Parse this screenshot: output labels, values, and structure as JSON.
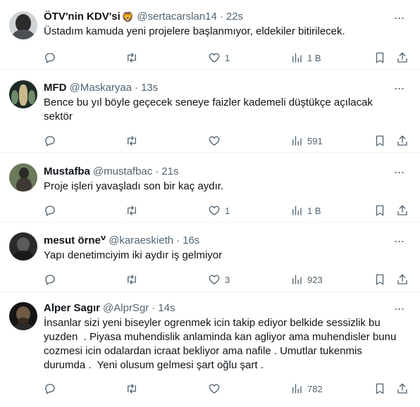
{
  "tweets": [
    {
      "name": "ÖTV'nin KDV'si",
      "badge": "🦁",
      "handle": "@sertacarslan14",
      "time": "22s",
      "text": "Üstadım kamuda yeni projelere başlanmıyor, eldekiler bitirilecek.",
      "likes": "1",
      "views": "1 B",
      "retweets": "",
      "replies": ""
    },
    {
      "name": "MFD",
      "handle": "@Maskaryaa",
      "time": "13s",
      "text": "Bence bu yıl böyle geçecek seneye faizler kademeli düştükçe açılacak\nsektör",
      "likes": "",
      "views": "591",
      "retweets": "",
      "replies": ""
    },
    {
      "name": "Mustafba",
      "handle": "@mustafbac",
      "time": "21s",
      "text": "Proje işleri yavaşladı son bir kaç aydır.",
      "likes": "1",
      "views": "1 B",
      "retweets": "",
      "replies": ""
    },
    {
      "name": "mesut örneⱽ",
      "handle": "@karaeskieth",
      "time": "16s",
      "text": "Yapı denetimciyim iki aydır iş gelmiyor",
      "likes": "3",
      "views": "923",
      "retweets": "",
      "replies": ""
    },
    {
      "name": "Alper Sagır",
      "handle": "@AlprSgr",
      "time": "14s",
      "text": "İnsanlar sizi yeni biseyler ogrenmek icin takip ediyor belkide sessizlik bu\nyuzden  . Piyasa muhendislik anlaminda kan agliyor ama muhendisler bunu\ncozmesi icin odalardan icraat bekliyor ama nafile . Umutlar tukenmis\ndurumda .  Yeni olusum gelmesi şart oğlu şart .",
      "likes": "",
      "views": "782",
      "retweets": "",
      "replies": ""
    }
  ],
  "separator": "·",
  "more_glyph": "···",
  "colors": {
    "text_primary": "#0f1419",
    "text_secondary": "#536471",
    "divider": "#eff3f4"
  },
  "icons": [
    "reply-icon",
    "retweet-icon",
    "like-icon",
    "views-icon",
    "bookmark-icon",
    "share-icon",
    "more-icon"
  ]
}
